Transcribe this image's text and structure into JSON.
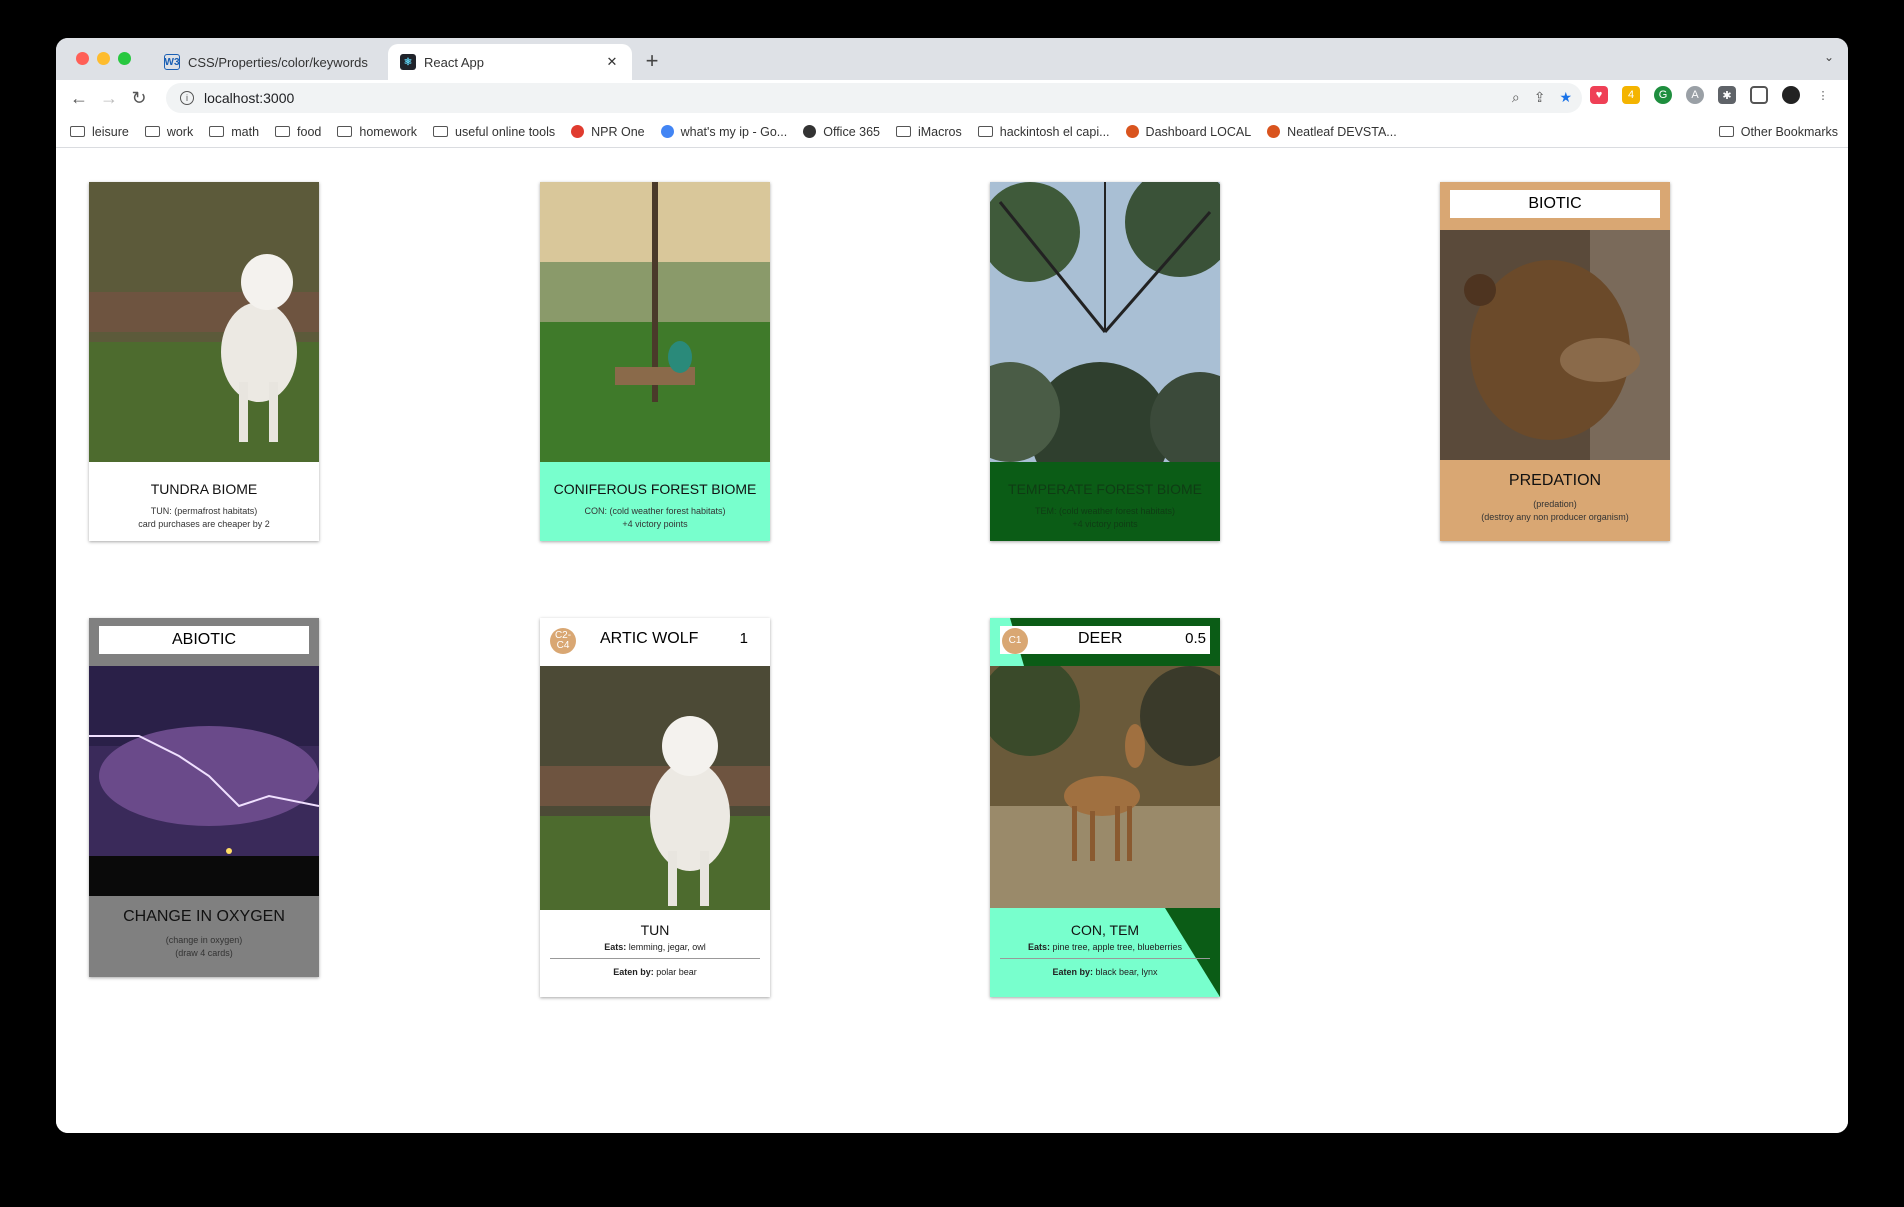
{
  "browser": {
    "tabs": [
      {
        "title": "CSS/Properties/color/keywords",
        "favicon": "W3"
      },
      {
        "title": "React App",
        "favicon": "react"
      }
    ],
    "new_tab_label": "+",
    "url": "localhost:3000"
  },
  "bookmarks": [
    {
      "label": "leisure",
      "icon": "folder-icon"
    },
    {
      "label": "work",
      "icon": "folder-icon"
    },
    {
      "label": "math",
      "icon": "folder-icon"
    },
    {
      "label": "food",
      "icon": "folder-icon"
    },
    {
      "label": "homework",
      "icon": "folder-icon"
    },
    {
      "label": "useful online tools",
      "icon": "folder-icon"
    },
    {
      "label": "NPR One",
      "icon": "npr-icon"
    },
    {
      "label": "what's my ip - Go...",
      "icon": "google-icon"
    },
    {
      "label": "Office 365",
      "icon": "globe-icon"
    },
    {
      "label": "iMacros",
      "icon": "folder-icon"
    },
    {
      "label": "hackintosh el capi...",
      "icon": "folder-icon"
    },
    {
      "label": "Dashboard LOCAL",
      "icon": "overleaf-icon"
    },
    {
      "label": "Neatleaf DEVSTA...",
      "icon": "overleaf-icon"
    }
  ],
  "other_bookmarks": "Other Bookmarks",
  "cards": {
    "tundra": {
      "title": "TUNDRA BIOME",
      "line1": "TUN: (permafrost habitats)",
      "line2": "card purchases are cheaper by 2"
    },
    "coniferous": {
      "title": "CONIFEROUS FOREST BIOME",
      "line1": "CON: (cold weather forest habitats)",
      "line2": "+4 victory points"
    },
    "temperate": {
      "title": "TEMPERATE FOREST BIOME",
      "line1": "TEM: (cold weather forest habitats)",
      "line2": "+4 victory points"
    },
    "predation": {
      "header": "BIOTIC",
      "title": "PREDATION",
      "line1": "(predation)",
      "line2": "(destroy any non producer organism)"
    },
    "oxygen": {
      "header": "ABIOTIC",
      "title": "CHANGE IN OXYGEN",
      "line1": "(change in oxygen)",
      "line2": "(draw 4 cards)"
    },
    "wolf": {
      "badge": "C2-C4",
      "name": "ARTIC WOLF",
      "points": "1",
      "habitat": "TUN",
      "eats_label": "Eats:",
      "eats": "lemming, jegar, owl",
      "eaten_label": "Eaten by:",
      "eaten": "polar bear"
    },
    "deer": {
      "badge": "C1",
      "name": "DEER",
      "points": "0.5",
      "habitat": "CON, TEM",
      "eats_label": "Eats:",
      "eats": "pine tree, apple tree, blueberries",
      "eaten_label": "Eaten by:",
      "eaten": "black bear, lynx"
    }
  },
  "colors": {
    "mint": "#78ffcd",
    "forest": "#0b5c16",
    "tan": "#d9a773",
    "gray": "#808080"
  }
}
